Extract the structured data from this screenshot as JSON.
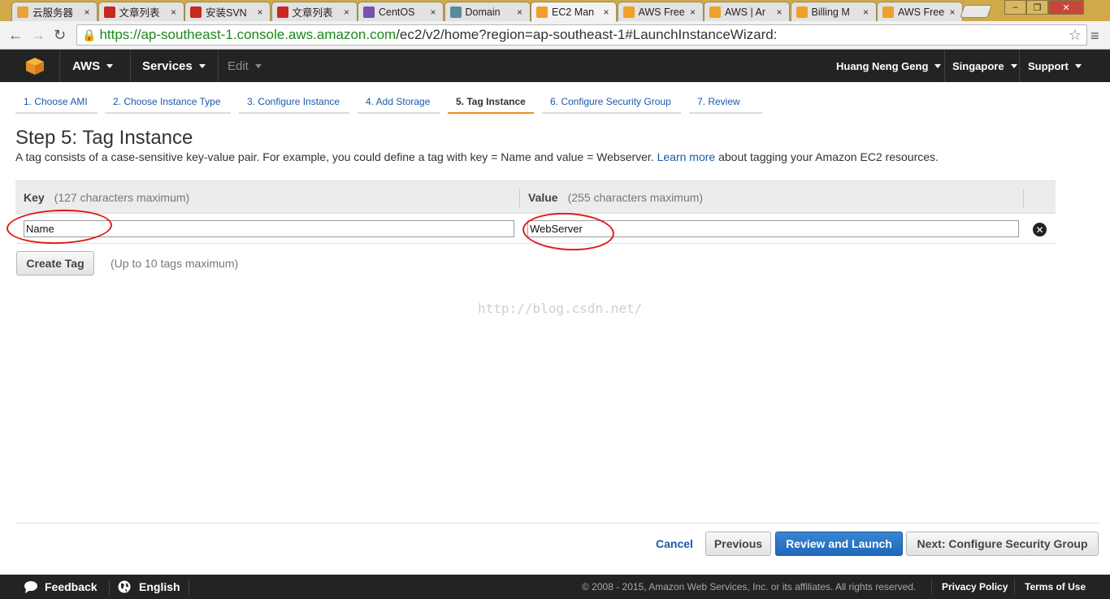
{
  "browser": {
    "tabs": [
      {
        "title": "云服务器",
        "color": "#e8a23a"
      },
      {
        "title": "文章列表",
        "color": "#c8281e"
      },
      {
        "title": "安装SVN",
        "color": "#c8281e"
      },
      {
        "title": "文章列表",
        "color": "#c8281e"
      },
      {
        "title": "CentOS",
        "color": "#7a4fb0"
      },
      {
        "title": "Domain",
        "color": "#5a8a9a"
      },
      {
        "title": "EC2 Man",
        "color": "#f0a028"
      },
      {
        "title": "AWS Free",
        "color": "#f0a028"
      },
      {
        "title": "AWS | Ar",
        "color": "#f0a028"
      },
      {
        "title": "Billing M",
        "color": "#f0a028"
      },
      {
        "title": "AWS Free",
        "color": "#f0a028"
      }
    ],
    "active_tab": 6,
    "close_glyph": "×",
    "url_scheme": "https://",
    "url_host": "ap-southeast-1.console.aws.amazon.com",
    "url_path": "/ec2/v2/home?region=ap-southeast-1#LaunchInstanceWizard:"
  },
  "nav": {
    "aws": "AWS",
    "services": "Services",
    "edit": "Edit",
    "user": "Huang Neng Geng",
    "region": "Singapore",
    "support": "Support"
  },
  "steps": [
    "1. Choose AMI",
    "2. Choose Instance Type",
    "3. Configure Instance",
    "4. Add Storage",
    "5. Tag Instance",
    "6. Configure Security Group",
    "7. Review"
  ],
  "active_step": 4,
  "page": {
    "title": "Step 5: Tag Instance",
    "desc_before": "A tag consists of a case-sensitive key-value pair. For example, you could define a tag with key = Name and value = Webserver.",
    "learn_more": "Learn more",
    "desc_after": "about tagging your Amazon EC2 resources."
  },
  "table": {
    "key_label": "Key",
    "key_hint": "(127 characters maximum)",
    "value_label": "Value",
    "value_hint": "(255 characters maximum)",
    "rows": [
      {
        "key": "Name",
        "value": "WebServer"
      }
    ]
  },
  "create_tag": {
    "label": "Create Tag",
    "note": "(Up to 10 tags maximum)"
  },
  "watermark": "http://blog.csdn.net/",
  "actions": {
    "cancel": "Cancel",
    "previous": "Previous",
    "review_launch": "Review and Launch",
    "next": "Next: Configure Security Group"
  },
  "footer": {
    "feedback": "Feedback",
    "english": "English",
    "copyright": "© 2008 - 2015, Amazon Web Services, Inc. or its affiliates. All rights reserved.",
    "privacy": "Privacy Policy",
    "terms": "Terms of Use"
  }
}
